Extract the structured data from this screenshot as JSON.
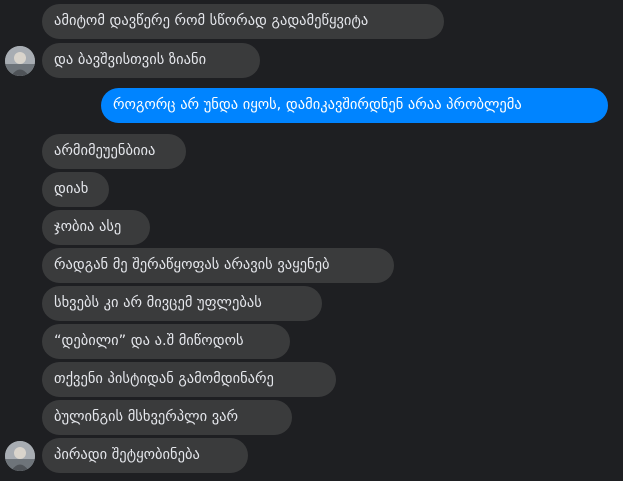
{
  "conversation": {
    "messages": [
      {
        "side": "in",
        "text": "ამიტომ დავწერე რომ სწორად გადამეწყვიტა"
      },
      {
        "side": "in",
        "text": "და ბავშვისთვის ზიანი"
      },
      {
        "side": "out",
        "text": "როგორც არ უნდა იყოს, დამიკავშირდნენ არაა პრობლემა"
      },
      {
        "side": "in",
        "text": "არმიმეუენბიია"
      },
      {
        "side": "in",
        "text": "დიახ"
      },
      {
        "side": "in",
        "text": "ჯობია ასე"
      },
      {
        "side": "in",
        "text": "რადგან მე შერაწყოფას არავის ვაყენებ"
      },
      {
        "side": "in",
        "text": "სხვებს კი არ მივცემ უფლებას"
      },
      {
        "side": "in",
        "text": "“დებილი” და ა.შ მიწოდოს"
      },
      {
        "side": "in",
        "text": "თქვენი პისტიდან გამომდინარე"
      },
      {
        "side": "in",
        "text": "ბულინგის მსხვერპლი ვარ"
      },
      {
        "side": "in",
        "text": "პირადი შეტყობინება"
      }
    ]
  },
  "colors": {
    "background": "#1e1f22",
    "incoming_bubble": "#3a3b3c",
    "outgoing_bubble": "#0084ff"
  },
  "icons": {
    "avatar": "user-avatar-photo"
  }
}
